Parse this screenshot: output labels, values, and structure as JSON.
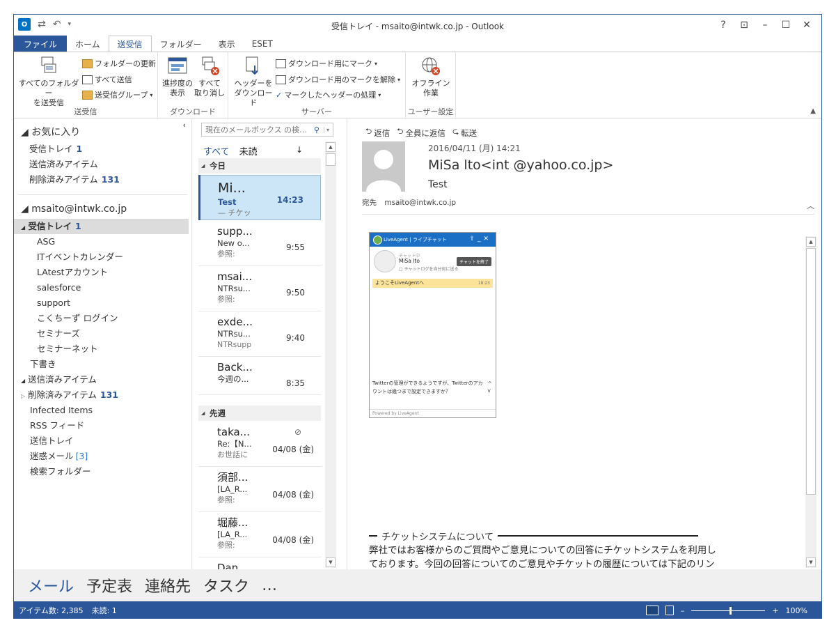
{
  "window": {
    "title": "受信トレイ - msaito@intwk.co.jp - Outlook",
    "app_logo": "O",
    "controls": [
      "?",
      "⊡",
      "–",
      "☐",
      "✕"
    ]
  },
  "tabs": [
    {
      "label": "ファイル"
    },
    {
      "label": "ホーム"
    },
    {
      "label": "送受信"
    },
    {
      "label": "フォルダー"
    },
    {
      "label": "表示"
    },
    {
      "label": "ESET"
    }
  ],
  "ribbon": {
    "sendreceive": {
      "all_folders": "すべてのフォルダー\nを送受信",
      "update_folder": "フォルダーの更新",
      "send_all": "すべて送信",
      "groups": "送受信グループ",
      "label": "送受信"
    },
    "download": {
      "progress": "進捗度の\n表示",
      "cancel_all": "すべて\n取り消し",
      "label": "ダウンロード"
    },
    "server": {
      "headers": "ヘッダーを\nダウンロード",
      "mark_dl": "ダウンロード用にマーク",
      "unmark_dl": "ダウンロード用のマークを解除",
      "process_marked": "マークしたヘッダーの処理",
      "label": "サーバー"
    },
    "user": {
      "offline": "オフライン\n作業",
      "label": "ユーザー設定"
    }
  },
  "folders": {
    "favorites_header": "お気に入り",
    "favorites": [
      {
        "label": "受信トレイ",
        "count": "1"
      },
      {
        "label": "送信済みアイテム",
        "count": ""
      },
      {
        "label": "削除済みアイテム",
        "count": "131"
      }
    ],
    "account": "msaito@intwk.co.jp",
    "inbox": {
      "label": "受信トレイ",
      "count": "1"
    },
    "subfolders": [
      "ASG",
      "ITイベントカレンダー",
      "LAtestアカウント",
      "salesforce",
      "support",
      "こくちーず ログイン",
      "セミナーズ",
      "セミナーネット"
    ],
    "others": [
      {
        "label": "下書き",
        "count": "",
        "arrow": ""
      },
      {
        "label": "送信済みアイテム",
        "count": "",
        "arrow": "◢"
      },
      {
        "label": "削除済みアイテム",
        "count": "131",
        "arrow": "▷"
      },
      {
        "label": "Infected Items",
        "count": "",
        "arrow": ""
      },
      {
        "label": "RSS フィード",
        "count": "",
        "arrow": ""
      },
      {
        "label": "送信トレイ",
        "count": "",
        "arrow": ""
      },
      {
        "label": "迷惑メール",
        "count": "[3]",
        "arrow": ""
      },
      {
        "label": "検索フォルダー",
        "count": "",
        "arrow": ""
      }
    ]
  },
  "messages": {
    "search_placeholder": "現在のメールボックス の検…",
    "filter_all": "すべて",
    "filter_unread": "未読",
    "sort": "↓",
    "group_today": "今日",
    "group_lastweek": "先週",
    "items": [
      {
        "from": "Mi...",
        "subj": "Test",
        "prev": "— チケッ",
        "time": "14:23"
      },
      {
        "from": "supp...",
        "subj": "New o...",
        "prev": "参照:",
        "time": "9:55"
      },
      {
        "from": "msai...",
        "subj": "NTRsu...",
        "prev": "参照:",
        "time": "9:50"
      },
      {
        "from": "exde...",
        "subj": "NTRsu...",
        "prev": "NTRsupp",
        "time": "9:40"
      },
      {
        "from": "Back...",
        "subj": "今週の...",
        "prev": "",
        "time": "8:35"
      },
      {
        "from": "taka...",
        "subj": "Re:【N...",
        "prev": "お世話に",
        "time": "04/08 (金)"
      },
      {
        "from": "須部...",
        "subj": "[LA_R...",
        "prev": "参照:",
        "time": "04/08 (金)"
      },
      {
        "from": "堀藤...",
        "subj": "[LA_R...",
        "prev": "参照:",
        "time": "04/08 (金)"
      },
      {
        "from": "Dan ...",
        "subj": "",
        "prev": "",
        "time": ""
      }
    ]
  },
  "reading": {
    "reply": "返信",
    "reply_all": "全員に返信",
    "forward": "転送",
    "date": "2016/04/11 (月) 14:21",
    "from": "MiSa lto<int @yahoo.co.jp>",
    "subject": "Test",
    "to_label": "宛先",
    "to": "msaito@intwk.co.jp",
    "embed": {
      "bar": "LiveAgent | ライブチャット",
      "status": "チャット中",
      "name": "MiSa lto",
      "checkbox": "□ チャットログを自分宛に送る",
      "end_btn": "チャットを終了",
      "welcome": "ようこそLiveAgentへ",
      "welcome_time": "18:23",
      "question": "Twitterの管理ができるようですが、Twitterのアカウントは幾つまで設定できますか？",
      "powered": "Powered by LiveAgent"
    },
    "section_title": "チケットシステムについて",
    "body": "弊社ではお客様からのご質問やご意見についての回答にチケットシステムを利用しております。今回の回答についてのご意見やチケットの履歴については下記のリンクからご覧いただけます"
  },
  "nav": [
    "メール",
    "予定表",
    "連絡先",
    "タスク",
    "…"
  ],
  "status": {
    "items": "アイテム数: 2,385",
    "unread": "未読: 1",
    "zoom": "100%"
  },
  "colors": {
    "accent": "#2b579a",
    "selected_bg": "#cde6f7"
  }
}
